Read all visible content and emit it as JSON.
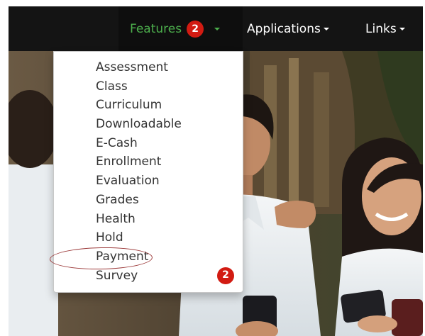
{
  "navbar": {
    "features": {
      "label": "Features",
      "badge": "2"
    },
    "applications": {
      "label": "Applications"
    },
    "links": {
      "label": "Links"
    }
  },
  "dropdown": {
    "items": [
      {
        "label": "Assessment"
      },
      {
        "label": "Class"
      },
      {
        "label": "Curriculum"
      },
      {
        "label": "Downloadable"
      },
      {
        "label": "E-Cash"
      },
      {
        "label": "Enrollment"
      },
      {
        "label": "Evaluation"
      },
      {
        "label": "Grades"
      },
      {
        "label": "Health"
      },
      {
        "label": "Hold"
      },
      {
        "label": "Payment",
        "circled": true
      },
      {
        "label": "Survey",
        "badge": "2"
      }
    ]
  },
  "colors": {
    "navbar_bg": "#141414",
    "active_link": "#4cae4c",
    "badge": "#d21b12",
    "annotation": "#9c3a3a"
  },
  "icons": [
    "caret-down-icon"
  ]
}
